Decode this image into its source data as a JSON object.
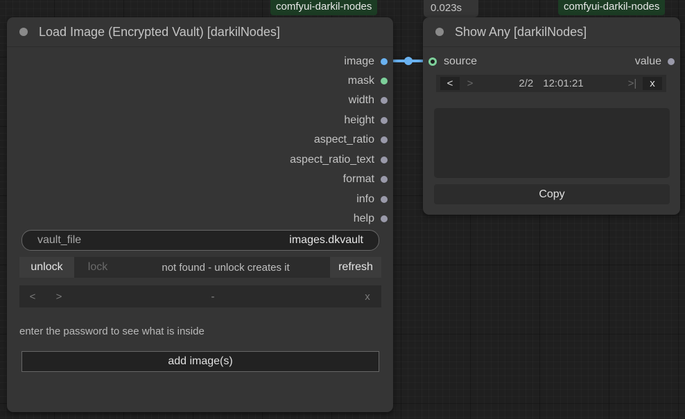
{
  "badges": {
    "left_node_badge": "comfyui-darkil-nodes",
    "right_node_badge": "comfyui-darkil-nodes",
    "exec_time": "0.023s"
  },
  "load_node": {
    "title": "Load Image (Encrypted Vault) [darkilNodes]",
    "outputs": [
      {
        "label": "image",
        "color": "#6ab2f0"
      },
      {
        "label": "mask",
        "color": "#7dd09a"
      },
      {
        "label": "width",
        "color": "#9a9aaa"
      },
      {
        "label": "height",
        "color": "#9a9aaa"
      },
      {
        "label": "aspect_ratio",
        "color": "#9a9aaa"
      },
      {
        "label": "aspect_ratio_text",
        "color": "#9a9aaa"
      },
      {
        "label": "format",
        "color": "#9a9aaa"
      },
      {
        "label": "info",
        "color": "#9a9aaa"
      },
      {
        "label": "help",
        "color": "#9a9aaa"
      }
    ],
    "vault_file": {
      "label": "vault_file",
      "value": "images.dkvault"
    },
    "controls": {
      "unlock": "unlock",
      "lock": "lock",
      "status": "not found - unlock creates it",
      "refresh": "refresh"
    },
    "nav": {
      "prev": "<",
      "next": ">",
      "current": "-",
      "close": "x"
    },
    "hint": "enter the password to see what is inside",
    "add_button": "add image(s)"
  },
  "show_node": {
    "title": "Show Any [darkilNodes]",
    "input_label": "source",
    "output_label": "value",
    "nav": {
      "prev": "<",
      "next": ">",
      "counter": "2/2",
      "time": "12:01:21",
      "last": ">|",
      "close": "x"
    },
    "display_text": "",
    "copy_button": "Copy"
  },
  "colors": {
    "link": "#6ab2f0",
    "badge_bg": "#1c3c24",
    "node_bg": "#353535",
    "source_slot": "#7dd09a"
  }
}
